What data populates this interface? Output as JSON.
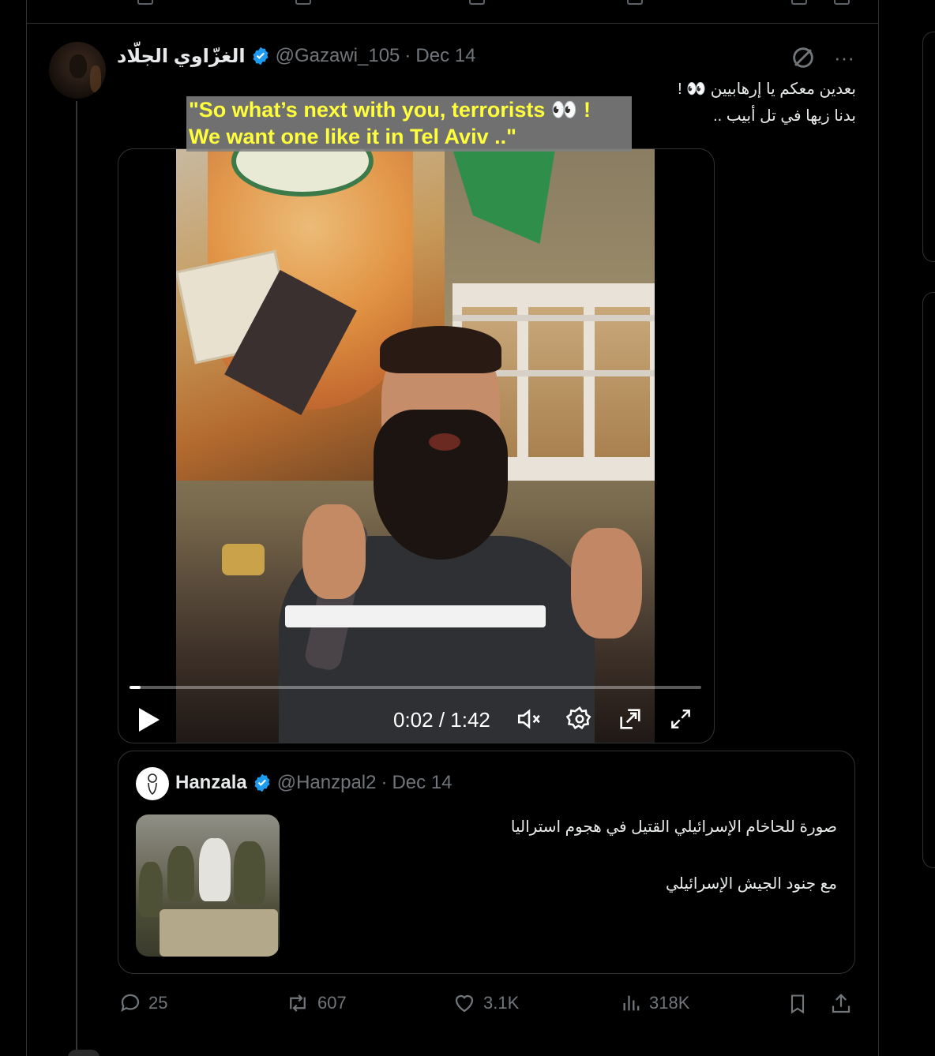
{
  "tweet": {
    "author_name": "الغزّاوي الجلّاد",
    "handle": "@Gazawi_105",
    "separator": "·",
    "date": "Dec 14",
    "text_line1": "بعدين معكم يا إرهابيين 👀 !",
    "text_line2": "بدنا زيها في تل أبيب ..",
    "more_icon": "···"
  },
  "video": {
    "caption_line1": "\"So what’s next with you, terrorists 👀 !",
    "caption_line2": "We want one like it in Tel Aviv ..\"",
    "time": "0:02 / 1:42",
    "progress_fraction": 0.02
  },
  "quote": {
    "author_name": "Hanzala",
    "handle": "@Hanzpal2",
    "separator": "·",
    "date": "Dec 14",
    "text_line1": "صورة للحاخام الإسرائيلي القتيل في هجوم استراليا",
    "text_line2": "مع جنود الجيش الإسرائيلي"
  },
  "actions": {
    "replies": "25",
    "reposts": "607",
    "likes": "3.1K",
    "views": "318K"
  },
  "colors": {
    "background": "#000000",
    "border": "#2f3336",
    "muted": "#71767b",
    "text": "#e7e9ea",
    "verified": "#1d9bf0",
    "caption_text": "#ffff3c"
  }
}
